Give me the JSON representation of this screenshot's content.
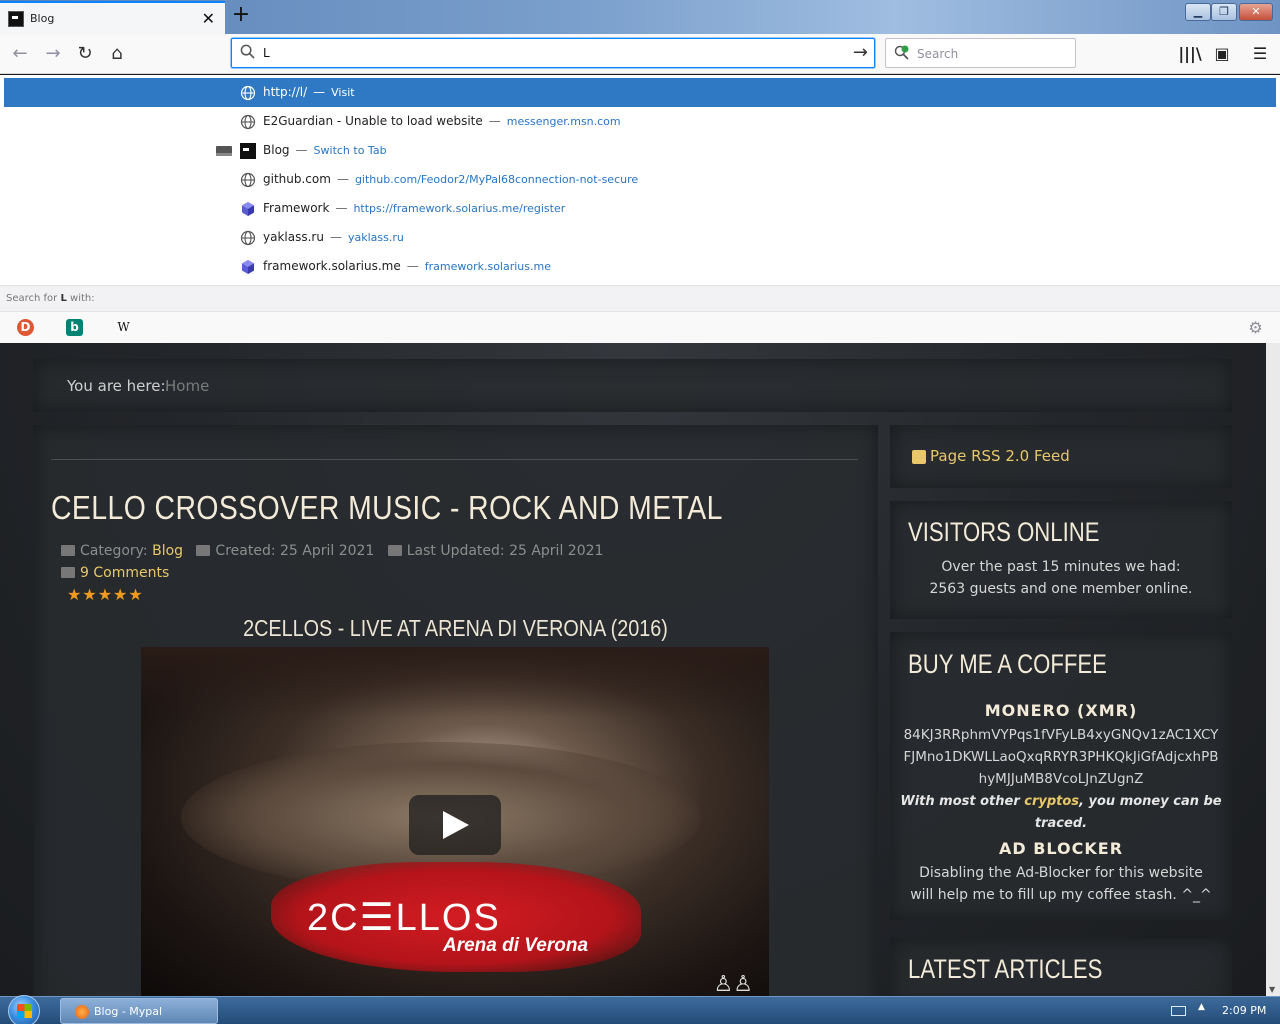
{
  "browser": {
    "tab": {
      "title": "Blog",
      "close": "✕"
    },
    "new_tab": "+",
    "window_controls": {
      "minimize": "▁",
      "maximize": "❐",
      "close": "✕"
    },
    "nav": {
      "back": "←",
      "forward": "→",
      "reload": "↻",
      "home": "⌂"
    },
    "urlbar": {
      "value": "L",
      "go": "→"
    },
    "searchbar": {
      "placeholder": "Search"
    },
    "toolbar": {
      "library": "|||\\",
      "sidebar": "▣",
      "menu": "☰"
    }
  },
  "autocomplete": {
    "rows": [
      {
        "title": "http://l/",
        "sep": "—",
        "url": "Visit",
        "icon": "globe-icon"
      },
      {
        "title": "E2Guardian - Unable to load website",
        "sep": "—",
        "url": "messenger.msn.com",
        "icon": "globe-icon"
      },
      {
        "title": "Blog",
        "sep": "—",
        "url": "Switch to Tab",
        "icon": "site-favicon"
      },
      {
        "title": "github.com",
        "sep": "—",
        "url": "github.com/Feodor2/MyPal68connection-not-secure",
        "icon": "globe-icon"
      },
      {
        "title": "Framework",
        "sep": "—",
        "url": "https://framework.solarius.me/register",
        "icon": "cube-icon"
      },
      {
        "title": "yaklass.ru",
        "sep": "—",
        "url": "yaklass.ru",
        "icon": "globe-icon"
      },
      {
        "title": "framework.solarius.me",
        "sep": "—",
        "url": "framework.solarius.me",
        "icon": "cube-icon"
      }
    ],
    "search_for_prefix": "Search for ",
    "search_for_term": "L",
    "search_for_suffix": " with:",
    "engines": [
      {
        "name": "duckduckgo",
        "glyph": "D",
        "color": "#de5833"
      },
      {
        "name": "bing",
        "glyph": "b",
        "color": "#008373"
      },
      {
        "name": "wikipedia",
        "glyph": "W",
        "color": "#ffffff"
      }
    ],
    "settings": "⚙"
  },
  "page": {
    "breadcrumb": {
      "label": "You are here:",
      "home": "Home"
    },
    "article": {
      "title": "CELLO CROSSOVER MUSIC - ROCK AND METAL",
      "category_label": "Category:",
      "category": "Blog",
      "created": "Created: 25 April 2021",
      "updated": "Last Updated: 25 April 2021",
      "comments": "9 Comments",
      "stars": "★★★★★",
      "video_title": "2CELLOS - LIVE AT ARENA DI VERONA (2016)",
      "video_logo": "2C☰LLOS",
      "video_logo_sub": "Arena di Verona"
    },
    "sidebar": {
      "rss": "Page RSS 2.0 Feed",
      "visitors_heading": "VISITORS ONLINE",
      "visitors_line1": "Over the past 15 minutes we had:",
      "visitors_line2": "2563 guests and one member online.",
      "coffee_heading": "BUY ME A COFFEE",
      "monero_heading": "MONERO (XMR)",
      "monero_address": "84KJ3RRphmVYPqs1fVFyLB4xyGNQv1zAC1XCYFJMno1DKWLLaoQxqRRYR3PHKQkJiGfAdjcxhPBhyMJJuMB8VcoLJnZUgnZ",
      "note_part1": "With most other ",
      "note_em": "cryptos",
      "note_part2": ", you money can be traced.",
      "adblock_heading": "AD BLOCKER",
      "adblock_text": "Disabling the Ad-Blocker for this website will help me to fill up my coffee stash. ^_^",
      "latest_heading": "LATEST ARTICLES"
    }
  },
  "taskbar": {
    "item_label": "Blog - Mypal",
    "clock": "2:09 PM"
  }
}
